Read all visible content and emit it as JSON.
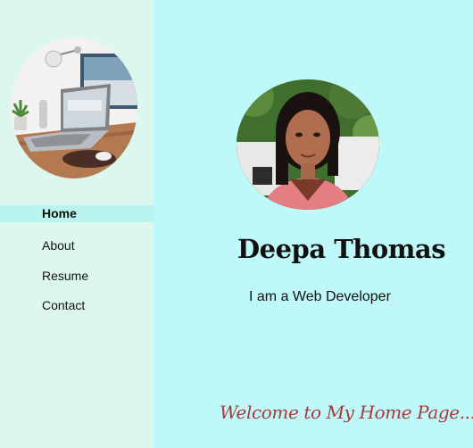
{
  "nav": {
    "items": [
      {
        "label": "Home",
        "active": true
      },
      {
        "label": "About",
        "active": false
      },
      {
        "label": "Resume",
        "active": false
      },
      {
        "label": "Contact",
        "active": false
      }
    ]
  },
  "profile": {
    "name": "Deepa Thomas",
    "tagline": "I am a Web Developer",
    "welcome": "Welcome to My Home Page..."
  },
  "icons": {
    "sidebar_image": "laptop-desk-image",
    "profile_image": "profile-photo"
  },
  "colors": {
    "sidebar_bg": "#dcf8ee",
    "main_bg": "#bff8f8",
    "active_nav_bg": "#b9f5ee",
    "welcome_text": "#a73b3b"
  }
}
